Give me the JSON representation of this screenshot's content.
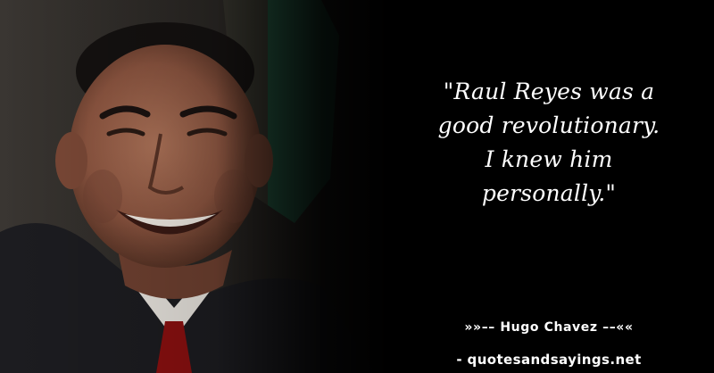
{
  "quote": {
    "lines": [
      "\"Raul Reyes was a",
      "good revolutionary.",
      "I knew him",
      "personally.\""
    ]
  },
  "author": {
    "text": "»»–– Hugo Chavez ––««"
  },
  "source": {
    "text": "- quotesandsayings.net"
  },
  "colors": {
    "background": "#000000",
    "text": "#ffffff",
    "flag_green": "#1f5a42",
    "tie_red": "#8a1010"
  }
}
